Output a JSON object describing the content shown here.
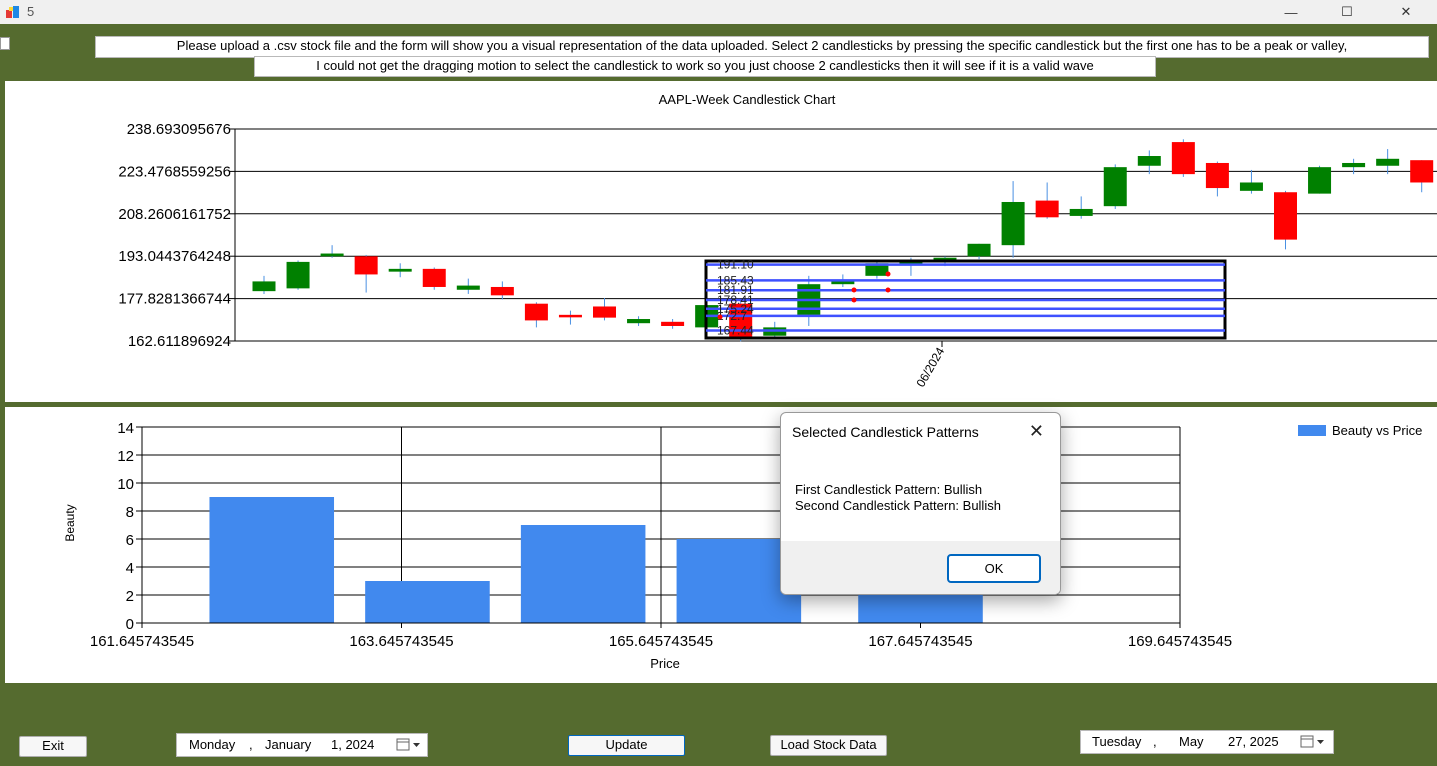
{
  "window": {
    "title": "5",
    "minimize": "—",
    "maximize": "☐",
    "close": "✕"
  },
  "instructions": {
    "line1": "Please upload a .csv stock file and the form will show you a visual representation of the data uploaded. Select 2 candlesticks by pressing the specific candlestick but the first one has to be a peak or valley,",
    "line2": "I could not get the dragging motion to select the candlestick to work so you just choose 2 candlesticks then it will see if it is a valid wave"
  },
  "candle_chart": {
    "title": "AAPL-Week Candlestick Chart",
    "y_ticks": [
      "238.693095676",
      "223.4768559256",
      "208.2606161752",
      "193.0443764248",
      "177.8281366744",
      "162.611896924"
    ],
    "x_tick": "06/2024",
    "colors": {
      "up": "#008000",
      "down": "#FF0000",
      "wick": "#4A90E2",
      "fib": "#3F51FF"
    },
    "fib_labels": [
      "191.10",
      "185.43",
      "181.91",
      "178.41",
      "175.24",
      "172.7",
      "167.44"
    ],
    "candles": [
      {
        "o": 180.5,
        "c": 184.0,
        "h": 186.0,
        "l": 179.5
      },
      {
        "o": 181.5,
        "c": 191.0,
        "h": 191.5,
        "l": 181.0
      },
      {
        "o": 193.0,
        "c": 194.0,
        "h": 197.0,
        "l": 192.5
      },
      {
        "o": 193.0,
        "c": 186.5,
        "h": 193.5,
        "l": 180.0
      },
      {
        "o": 187.5,
        "c": 188.5,
        "h": 190.5,
        "l": 185.5
      },
      {
        "o": 188.5,
        "c": 182.0,
        "h": 189.0,
        "l": 181.0
      },
      {
        "o": 181.0,
        "c": 182.5,
        "h": 185.0,
        "l": 179.5
      },
      {
        "o": 182.0,
        "c": 179.0,
        "h": 184.0,
        "l": 177.5
      },
      {
        "o": 176.0,
        "c": 170.0,
        "h": 176.5,
        "l": 167.5
      },
      {
        "o": 172.0,
        "c": 171.5,
        "h": 173.5,
        "l": 168.5
      },
      {
        "o": 175.0,
        "c": 171.0,
        "h": 178.0,
        "l": 170.0
      },
      {
        "o": 169.0,
        "c": 170.5,
        "h": 171.5,
        "l": 168.0
      },
      {
        "o": 169.5,
        "c": 168.0,
        "h": 170.5,
        "l": 167.0
      },
      {
        "o": 167.5,
        "c": 175.5,
        "h": 176.5,
        "l": 167.0
      },
      {
        "o": 176.0,
        "c": 164.0,
        "h": 177.0,
        "l": 162.5
      },
      {
        "o": 164.5,
        "c": 167.5,
        "h": 169.5,
        "l": 163.5
      },
      {
        "o": 172.0,
        "c": 183.0,
        "h": 186.0,
        "l": 168.0
      },
      {
        "o": 183.0,
        "c": 184.0,
        "h": 186.5,
        "l": 182.0
      },
      {
        "o": 186.0,
        "c": 190.5,
        "h": 191.0,
        "l": 185.0
      },
      {
        "o": 190.0,
        "c": 191.0,
        "h": 192.5,
        "l": 186.0
      },
      {
        "o": 191.5,
        "c": 192.5,
        "h": 193.0,
        "l": 189.5
      },
      {
        "o": 193.0,
        "c": 197.5,
        "h": 197.5,
        "l": 192.0
      },
      {
        "o": 197.0,
        "c": 212.5,
        "h": 220.0,
        "l": 192.5
      },
      {
        "o": 213.0,
        "c": 207.0,
        "h": 219.5,
        "l": 206.5
      },
      {
        "o": 207.5,
        "c": 210.0,
        "h": 214.5,
        "l": 206.5
      },
      {
        "o": 211.0,
        "c": 225.0,
        "h": 226.0,
        "l": 210.0
      },
      {
        "o": 225.5,
        "c": 229.0,
        "h": 231.0,
        "l": 222.5
      },
      {
        "o": 234.0,
        "c": 222.5,
        "h": 235.0,
        "l": 221.5
      },
      {
        "o": 226.5,
        "c": 217.5,
        "h": 227.0,
        "l": 214.5
      },
      {
        "o": 216.5,
        "c": 219.5,
        "h": 224.0,
        "l": 215.5
      },
      {
        "o": 216.0,
        "c": 199.0,
        "h": 216.5,
        "l": 195.5
      },
      {
        "o": 215.5,
        "c": 225.0,
        "h": 225.5,
        "l": 215.5
      },
      {
        "o": 225.0,
        "c": 226.5,
        "h": 228.0,
        "l": 222.5
      },
      {
        "o": 225.5,
        "c": 228.0,
        "h": 231.5,
        "l": 222.5
      },
      {
        "o": 227.5,
        "c": 219.5,
        "h": 227.5,
        "l": 216.0
      }
    ]
  },
  "chart_data": {
    "type": "bar",
    "title": "",
    "xlabel": "Price",
    "ylabel": "Beauty",
    "legend": "Beauty vs Price",
    "legend_position": "top-right",
    "x_ticks": [
      "161.645743545",
      "163.645743545",
      "165.645743545",
      "167.645743545",
      "169.645743545"
    ],
    "y_ticks": [
      "14",
      "12",
      "10",
      "8",
      "6",
      "4",
      "2",
      "0"
    ],
    "xlim": [
      161.645743545,
      169.645743545
    ],
    "ylim": [
      0,
      14
    ],
    "categories": [
      162.645743545,
      163.845743545,
      165.045743545,
      166.245743545,
      167.645743545
    ],
    "values": [
      9,
      3,
      7,
      6,
      2
    ],
    "bar_color": "#4189EE"
  },
  "dialog": {
    "title": "Selected Candlestick Patterns",
    "line1": "First Candlestick Pattern: Bullish",
    "line2": "Second Candlestick Pattern: Bullish",
    "ok": "OK"
  },
  "controls": {
    "exit": "Exit",
    "update": "Update",
    "load": "Load Stock Data",
    "start_date": {
      "day": "Monday",
      "month": "January",
      "date": "1, 2024"
    },
    "end_date": {
      "day": "Tuesday",
      "month": "May",
      "date": "27, 2025"
    }
  }
}
